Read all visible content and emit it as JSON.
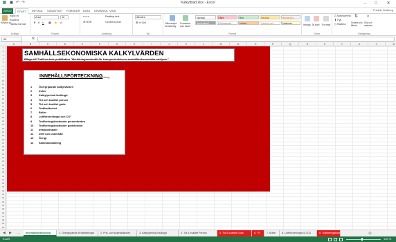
{
  "window": {
    "title": "Kalkylblad.xlsx - Excel",
    "minimize": "–",
    "maximize": "□",
    "close": "✕"
  },
  "ribbon_tabs": [
    "ARKIV",
    "START",
    "INFOGA",
    "SIDLAYOUT",
    "FORMLER",
    "DATA",
    "GRANSKA",
    "VISA"
  ],
  "user": "Fredrik Hedborg",
  "ribbon": {
    "clipboard": {
      "paste": "Klistra in",
      "cut": "Klipp ut",
      "copy": "Kopiera",
      "format_painter": "Hämta format",
      "group": "Urklipp"
    },
    "font": {
      "name": "Arial",
      "size": "10",
      "group": "Tecken"
    },
    "alignment": {
      "wrap": "Radbryt text",
      "merge": "Centrera över",
      "group": "Justering"
    },
    "number": {
      "format": "Allmänt",
      "group": "Tal"
    },
    "styles": {
      "conditional": "Villkorsstyrd formatering",
      "table": "Formatera som tabell",
      "cells": [
        {
          "label": "Normal",
          "bg": "#ffffff",
          "fg": "#222222"
        },
        {
          "label": "Dålig",
          "bg": "#ffc7ce",
          "fg": "#9c0006"
        },
        {
          "label": "Bra",
          "bg": "#c6efce",
          "fg": "#006100"
        },
        {
          "label": "Neutral",
          "bg": "#ffeb9c",
          "fg": "#9c5700"
        },
        {
          "label": "Beräkning",
          "bg": "#f2f2f2",
          "fg": "#fa7d00"
        },
        {
          "label": "Kontrollcell",
          "bg": "#a5a5a5",
          "fg": "#ffffff"
        },
        {
          "label": "Förklarande...",
          "bg": "#ffffff",
          "fg": "#7f7f7f"
        },
        {
          "label": "Indata",
          "bg": "#ffcc99",
          "fg": "#3f3f76"
        },
        {
          "label": "Länkad cell",
          "bg": "#ffffff",
          "fg": "#fa7d00"
        },
        {
          "label": "Notering",
          "bg": "#ffffcc",
          "fg": "#222222"
        }
      ],
      "group": "Format"
    },
    "cells": {
      "insert": "Infoga",
      "delete": "Ta bort",
      "format": "Format",
      "group": "Celler"
    },
    "editing": {
      "autosum": "Autosumma",
      "fill": "Fyll",
      "clear": "Radera",
      "sort": "Sortera och filtrera",
      "find": "Sök och markera",
      "group": "Redigering"
    }
  },
  "formula_bar": {
    "cell_ref": "A1",
    "fx": "fx",
    "content": ""
  },
  "columns": [
    "A",
    "B",
    "C",
    "D",
    "E",
    "F",
    "G",
    "H",
    "I",
    "J",
    "K",
    "L",
    "M",
    "N",
    "O",
    "P",
    "Q",
    "R",
    "S",
    "T",
    "U",
    "V",
    "W"
  ],
  "rows": [
    "1",
    "2",
    "3",
    "4",
    "5",
    "6",
    "7",
    "8",
    "9",
    "10",
    "11",
    "12",
    "13",
    "14",
    "15",
    "16",
    "17",
    "18",
    "19",
    "20",
    "21",
    "22",
    "23",
    "24",
    "25",
    "26",
    "27",
    "28",
    "29",
    "30",
    "31",
    "32",
    "33",
    "34",
    "35",
    "36",
    "37",
    "38",
    "39",
    "40",
    "41",
    "42",
    "43",
    "44",
    "45",
    "46",
    "47",
    "48",
    "49",
    "50"
  ],
  "sheet": {
    "title": "SAMHÄLLSEKONOMISKA KALKYLVÄRDEN",
    "subtitle": "Bilaga till Trafikverkets publikation \"Beräkningsmetodik för transportsektorns samhällsekonomiska analyser\"",
    "toc_heading": "INNEHÅLLSFÖRTECKNING",
    "toc_backref": "1 Vårdning",
    "toc": [
      {
        "n": "1",
        "label": "Övergripande kalkylvärden"
      },
      {
        "n": "2",
        "label": "Index"
      },
      {
        "n": "3",
        "label": "Kalkylperiod-livslängd"
      },
      {
        "n": "4",
        "label": "Tid och kvalitet person"
      },
      {
        "n": "5",
        "label": "Tid och kvalitet gods"
      },
      {
        "n": "6",
        "label": "Trafiksäkerhet"
      },
      {
        "n": "7",
        "label": "Buller"
      },
      {
        "n": "8",
        "label": "Luftföroreningar och CO²"
      },
      {
        "n": "9",
        "label": "Trafikeringskostnader personfordon"
      },
      {
        "n": "10",
        "label": "Trafikeringskostnader godsfordon"
      },
      {
        "n": "11",
        "label": "Infrakostnader"
      },
      {
        "n": "12",
        "label": "Drift och underhåll"
      },
      {
        "n": "13",
        "label": "Övrigt"
      },
      {
        "n": "14",
        "label": "Sammanställning"
      }
    ]
  },
  "sheet_tabs": [
    {
      "label": "Innehållsförteckning",
      "state": "active"
    },
    {
      "label": "1. Övergripande förutsättningar",
      "state": "normal"
    },
    {
      "label": "2. Pris- och kostnadsindex",
      "state": "normal"
    },
    {
      "label": "3. Kalkylperiod-livslängd",
      "state": "normal"
    },
    {
      "label": "4. Tid & kvalitet Person",
      "state": "normal"
    },
    {
      "label": "5. Tid & kvalitet Gods",
      "state": "red"
    },
    {
      "label": "6. TS",
      "state": "red"
    },
    {
      "label": "7. Buller",
      "state": "normal"
    },
    {
      "label": "8. Luftföroreningar & CO2",
      "state": "normal"
    },
    {
      "label": "9. Trafikeringskostn.",
      "state": "red"
    }
  ],
  "status": {
    "text": "KLAR",
    "zoom": "100 %"
  },
  "colors": {
    "accent": "#217346",
    "sheet_red": "#c00000",
    "tab_red": "#e01f1f"
  }
}
